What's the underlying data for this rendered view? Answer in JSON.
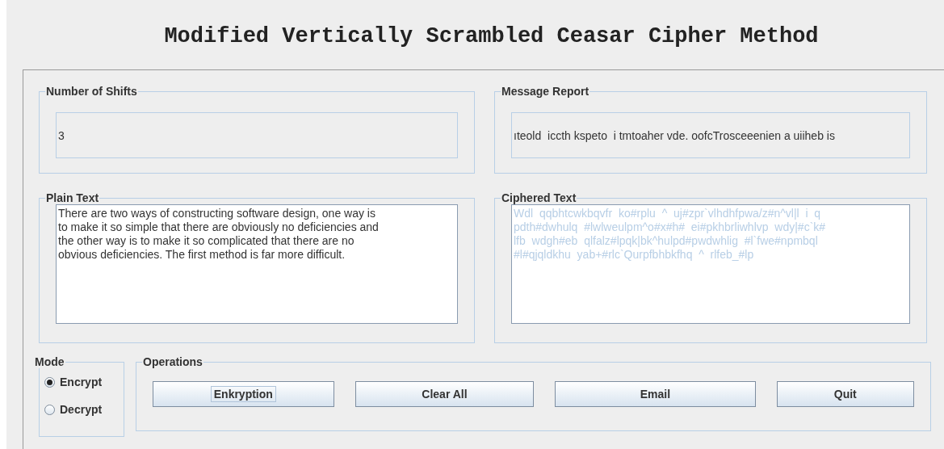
{
  "title": "Modified Vertically Scrambled Ceasar Cipher Method",
  "shifts": {
    "label": "Number of Shifts",
    "value": "3"
  },
  "report": {
    "label": "Message Report",
    "value": "ıteold  iccth kspeto  i tmtoaher vde. oofcTrosceeenien a uiiheb is"
  },
  "plain": {
    "label": "Plain Text",
    "value": "There are two ways of constructing software design, one way is\nto make it so simple that there are obviously no deficiencies and\nthe other way is to make it so complicated that there are no\nobvious deficiencies. The first method is far more difficult.",
    "disabled": false
  },
  "cipher": {
    "label": "Ciphered Text",
    "value": "Wdl  qqbhtcwkbqvfr  ko#rplu  ^  uj#zpr`vlhdhfpwa/z#n^vl|l  i  q\npdth#dwhulq  #lwlweulpm^o#x#h#  ei#pkhbrliwhlvp  wdy|#c`k#\nlfb  wdgh#eb  qlfalz#lpqk|bk^hulpd#pwdwhlig  #l`fwe#npmbql\n#l#qjqldkhu  yab+#rlc`Qurpfbhbkfhq  ^  rlfeb_#lp",
    "disabled": true
  },
  "mode": {
    "label": "Mode",
    "options": [
      {
        "label": "Encrypt",
        "selected": true
      },
      {
        "label": "Decrypt",
        "selected": false
      }
    ]
  },
  "operations": {
    "label": "Operations",
    "buttons": [
      {
        "label": "Enkryption",
        "focused": true
      },
      {
        "label": "Clear All",
        "focused": false
      },
      {
        "label": "Email",
        "focused": false
      },
      {
        "label": "Quit",
        "focused": false
      }
    ]
  }
}
